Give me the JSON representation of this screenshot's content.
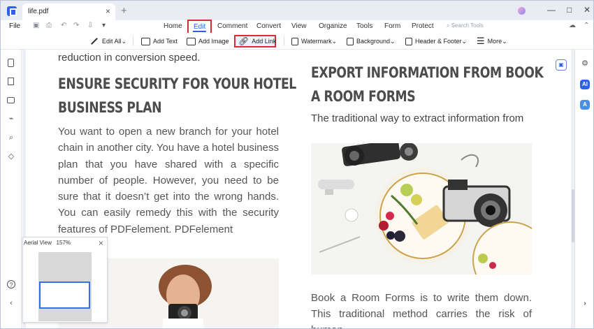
{
  "window": {
    "tab_title": "life.pdf",
    "close_glyph": "×",
    "new_tab": "+",
    "minimize": "—",
    "maximize": "□",
    "close": "✕"
  },
  "menubar": {
    "file": "File",
    "items": [
      "Home",
      "Edit",
      "Comment",
      "Convert",
      "View",
      "Organize",
      "Tools",
      "Form",
      "Protect"
    ],
    "search_tools": "Search Tools"
  },
  "toolbar": {
    "edit_all": "Edit All",
    "add_text": "Add Text",
    "add_image": "Add Image",
    "add_link": "Add Link",
    "watermark": "Watermark",
    "background": "Background",
    "header_footer": "Header & Footer",
    "more": "More"
  },
  "document": {
    "top_text": "reduction in conversion speed.",
    "left_heading": [
      "ENSURE SECURITY FOR YOUR HOTEL",
      "BUSINESS PLAN"
    ],
    "left_paragraph": "You want to open a new branch for your hotel chain in another city. You have a hotel business plan that you have shared with a specific number of people. However, you need to be sure that it doesn’t get into the wrong hands. You can easily remedy this with the security features of PDFelement. PDFelement",
    "right_heading": [
      "EXPORT INFORMATION FROM BOOK",
      "A ROOM FORMS"
    ],
    "right_subtitle": "The traditional way to extract information from",
    "right_bottom": "Book a Room Forms is to write them down. This traditional method carries the risk of human"
  },
  "aerial": {
    "title": "Aerial View",
    "zoom": "157%",
    "close": "×"
  },
  "right_rail": {
    "ai": "AI",
    "translate": "A"
  },
  "colors": {
    "accent": "#2d62e8",
    "highlight": "#d82b35"
  }
}
